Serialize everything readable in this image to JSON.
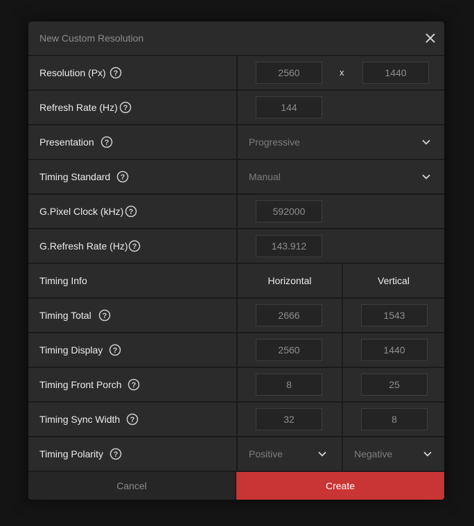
{
  "dialog": {
    "title": "New Custom Resolution",
    "close_icon": "close-icon"
  },
  "resolution": {
    "label": "Resolution (Px)",
    "width": "2560",
    "separator": "x",
    "height": "1440"
  },
  "refresh_rate": {
    "label": "Refresh Rate (Hz)",
    "value": "144"
  },
  "presentation": {
    "label": "Presentation",
    "selected": "Progressive"
  },
  "timing_standard": {
    "label": "Timing Standard",
    "selected": "Manual"
  },
  "pixel_clock": {
    "label": "G.Pixel Clock (kHz)",
    "value": "592000"
  },
  "g_refresh_rate": {
    "label": "G.Refresh Rate (Hz)",
    "value": "143.912"
  },
  "timing_info": {
    "label": "Timing Info",
    "horizontal": "Horizontal",
    "vertical": "Vertical"
  },
  "timing_total": {
    "label": "Timing Total",
    "horizontal": "2666",
    "vertical": "1543"
  },
  "timing_display": {
    "label": "Timing Display",
    "horizontal": "2560",
    "vertical": "1440"
  },
  "timing_front_porch": {
    "label": "Timing Front Porch",
    "horizontal": "8",
    "vertical": "25"
  },
  "timing_sync_width": {
    "label": "Timing Sync Width",
    "horizontal": "32",
    "vertical": "8"
  },
  "timing_polarity": {
    "label": "Timing Polarity",
    "horizontal": "Positive",
    "vertical": "Negative"
  },
  "footer": {
    "cancel_label": "Cancel",
    "create_label": "Create"
  },
  "colors": {
    "background": "#141414",
    "panel": "#2b2b2b",
    "accent_create": "#c93434",
    "text_primary": "#ececec",
    "text_muted": "#8c8c8c"
  },
  "icons": {
    "help": "help-circle-icon",
    "chevron": "chevron-down-icon",
    "close": "close-icon"
  }
}
